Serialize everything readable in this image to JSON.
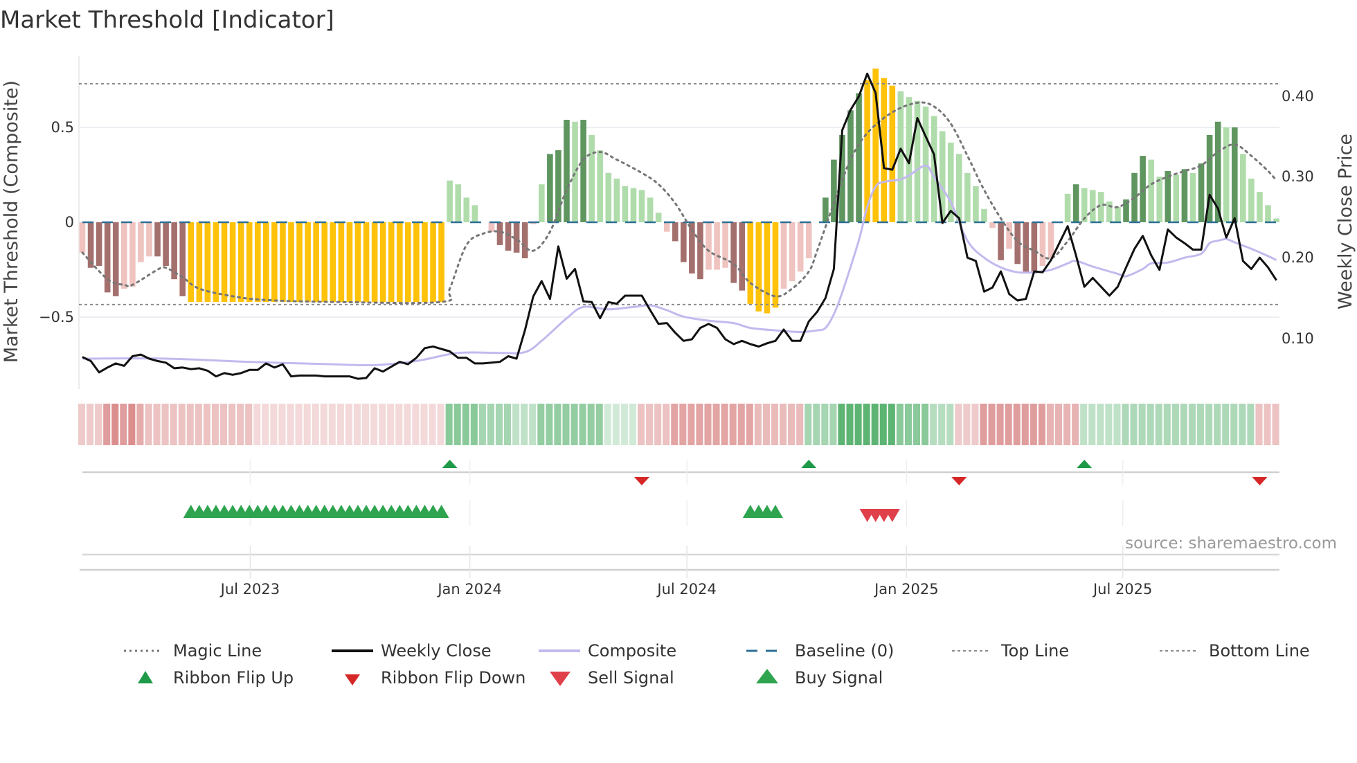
{
  "chart_data": {
    "type": "bar",
    "title": "Market Threshold [Indicator]",
    "ylabel": "Market Threshold (Composite)",
    "y2label": "Weekly Close Price",
    "ylim": [
      -0.85,
      0.87
    ],
    "y2lim": [
      0.02,
      0.45
    ],
    "yticks": [
      {
        "v": 0.5,
        "label": "0.5"
      },
      {
        "v": 0,
        "label": "0"
      },
      {
        "v": -0.5,
        "label": "−0.5"
      }
    ],
    "y2ticks": [
      {
        "v": 0.4,
        "label": "0.40"
      },
      {
        "v": 0.3,
        "label": "0.30"
      },
      {
        "v": 0.2,
        "label": "0.20"
      },
      {
        "v": 0.1,
        "label": "0.10"
      }
    ],
    "xticks": [
      {
        "week": 20.1,
        "label": "Jul 2023"
      },
      {
        "week": 46.4,
        "label": "Jan 2024"
      },
      {
        "week": 72.4,
        "label": "Jul 2024"
      },
      {
        "week": 98.7,
        "label": "Jan 2025"
      },
      {
        "week": 124.6,
        "label": "Jul 2025"
      }
    ],
    "weeks": 144,
    "top_line": 0.73,
    "bottom_line": -0.434,
    "bar_colors": {
      "D": "#a4706d",
      "P": "#efc3bf",
      "Y": "#ffc20a",
      "G": "#5f9660",
      "L": "#b0dcab"
    },
    "bar_kinds": "PDDDDPPPPDDDDYYYYYYYYYYYYYYYYYYYYYYYYYYYYYYYLLLLNPDDDDPLGGGLGLLLLLLLLLPDDDDPPPDDYYYYPPPPNGGGGGYYYYLLLLLLLLLLLPDPDDDPPNLGLLLLLGGGLLGLGLGGGLGLLLLL",
    "composite_bars": [
      -0.16,
      -0.24,
      -0.23,
      -0.37,
      -0.39,
      -0.35,
      -0.34,
      -0.21,
      -0.18,
      -0.18,
      -0.23,
      -0.3,
      -0.39,
      -0.42,
      -0.42,
      -0.42,
      -0.42,
      -0.42,
      -0.42,
      -0.42,
      -0.42,
      -0.42,
      -0.42,
      -0.42,
      -0.42,
      -0.42,
      -0.42,
      -0.42,
      -0.42,
      -0.42,
      -0.42,
      -0.42,
      -0.42,
      -0.42,
      -0.42,
      -0.42,
      -0.42,
      -0.42,
      -0.42,
      -0.42,
      -0.42,
      -0.42,
      -0.42,
      -0.42,
      0.22,
      0.2,
      0.13,
      0.09,
      null,
      -0.05,
      -0.12,
      -0.15,
      -0.16,
      -0.19,
      -0.01,
      0.2,
      0.36,
      0.38,
      0.54,
      0.53,
      0.54,
      0.46,
      0.38,
      0.26,
      0.23,
      0.19,
      0.18,
      0.17,
      0.13,
      0.05,
      -0.05,
      -0.1,
      -0.21,
      -0.27,
      -0.3,
      -0.25,
      -0.25,
      -0.24,
      -0.32,
      -0.36,
      -0.43,
      -0.47,
      -0.48,
      -0.45,
      -0.35,
      -0.31,
      -0.26,
      -0.19,
      null,
      0.13,
      0.33,
      0.46,
      0.59,
      0.68,
      0.75,
      0.81,
      0.76,
      0.72,
      0.69,
      0.66,
      0.64,
      0.61,
      0.56,
      0.48,
      0.42,
      0.36,
      0.26,
      0.19,
      0.07,
      -0.03,
      -0.2,
      -0.14,
      -0.22,
      -0.27,
      -0.27,
      -0.23,
      -0.19,
      null,
      0.15,
      0.2,
      0.18,
      0.17,
      0.16,
      0.11,
      0.08,
      0.12,
      0.26,
      0.35,
      0.33,
      0.24,
      0.27,
      0.25,
      0.28,
      0.26,
      0.31,
      0.46,
      0.53,
      0.5,
      0.5,
      0.36,
      0.23,
      0.16,
      0.09,
      0.02
    ],
    "magic_line": [
      [
        0,
        -0.16
      ],
      [
        3,
        -0.3
      ],
      [
        5,
        -0.33
      ],
      [
        6,
        -0.33
      ],
      [
        9,
        -0.25
      ],
      [
        10,
        -0.24
      ],
      [
        12,
        -0.29
      ],
      [
        14,
        -0.35
      ],
      [
        18,
        -0.39
      ],
      [
        22,
        -0.41
      ],
      [
        30,
        -0.42
      ],
      [
        43,
        -0.42
      ],
      [
        44,
        -0.35
      ],
      [
        46,
        -0.12
      ],
      [
        48,
        -0.06
      ],
      [
        50,
        -0.05
      ],
      [
        52,
        -0.09
      ],
      [
        54,
        -0.15
      ],
      [
        56,
        -0.05
      ],
      [
        58,
        0.17
      ],
      [
        60,
        0.33
      ],
      [
        62,
        0.37
      ],
      [
        64,
        0.33
      ],
      [
        67,
        0.26
      ],
      [
        69,
        0.2
      ],
      [
        71,
        0.1
      ],
      [
        73,
        -0.04
      ],
      [
        75,
        -0.15
      ],
      [
        78,
        -0.22
      ],
      [
        80,
        -0.32
      ],
      [
        83,
        -0.39
      ],
      [
        85,
        -0.35
      ],
      [
        87,
        -0.26
      ],
      [
        88,
        -0.15
      ],
      [
        90,
        0.1
      ],
      [
        92,
        0.33
      ],
      [
        94,
        0.47
      ],
      [
        97,
        0.58
      ],
      [
        100,
        0.63
      ],
      [
        102,
        0.61
      ],
      [
        104,
        0.52
      ],
      [
        106,
        0.35
      ],
      [
        108,
        0.17
      ],
      [
        110,
        0.02
      ],
      [
        112,
        -0.1
      ],
      [
        114,
        -0.15
      ],
      [
        116,
        -0.19
      ],
      [
        118,
        -0.1
      ],
      [
        120,
        0.02
      ],
      [
        122,
        0.09
      ],
      [
        124,
        0.08
      ],
      [
        126,
        0.13
      ],
      [
        128,
        0.2
      ],
      [
        130,
        0.24
      ],
      [
        132,
        0.27
      ],
      [
        134,
        0.3
      ],
      [
        136,
        0.37
      ],
      [
        138,
        0.41
      ],
      [
        140,
        0.35
      ],
      [
        142,
        0.27
      ],
      [
        143,
        0.22
      ]
    ],
    "weekly_close": [
      0.077,
      0.072,
      0.058,
      0.064,
      0.069,
      0.066,
      0.078,
      0.08,
      0.075,
      0.072,
      0.07,
      0.063,
      0.064,
      0.062,
      0.063,
      0.06,
      0.053,
      0.057,
      0.055,
      0.057,
      0.061,
      0.061,
      0.069,
      0.064,
      0.068,
      0.053,
      0.054,
      0.054,
      0.054,
      0.053,
      0.053,
      0.053,
      0.053,
      0.05,
      0.051,
      0.063,
      0.059,
      0.065,
      0.071,
      0.068,
      0.076,
      0.088,
      0.09,
      0.087,
      0.084,
      0.076,
      0.076,
      0.069,
      0.069,
      0.07,
      0.071,
      0.078,
      0.075,
      0.11,
      0.152,
      0.171,
      0.149,
      0.214,
      0.174,
      0.186,
      0.146,
      0.145,
      0.125,
      0.145,
      0.143,
      0.153,
      0.153,
      0.153,
      0.135,
      0.118,
      0.119,
      0.107,
      0.097,
      0.099,
      0.113,
      0.118,
      0.113,
      0.099,
      0.093,
      0.097,
      0.093,
      0.09,
      0.094,
      0.097,
      0.111,
      0.097,
      0.097,
      0.121,
      0.133,
      0.15,
      0.186,
      0.358,
      0.383,
      0.4,
      0.428,
      0.404,
      0.311,
      0.309,
      0.335,
      0.317,
      0.373,
      0.35,
      0.328,
      0.243,
      0.258,
      0.249,
      0.2,
      0.196,
      0.158,
      0.163,
      0.183,
      0.155,
      0.147,
      0.149,
      0.183,
      0.182,
      0.197,
      0.218,
      0.239,
      0.203,
      0.164,
      0.175,
      0.164,
      0.153,
      0.164,
      0.188,
      0.211,
      0.227,
      0.203,
      0.185,
      0.235,
      0.225,
      0.218,
      0.21,
      0.21,
      0.278,
      0.261,
      0.225,
      0.249,
      0.196,
      0.186,
      0.2,
      0.188,
      0.172
    ],
    "composite_line": [
      [
        0,
        0.075
      ],
      [
        10,
        0.075
      ],
      [
        20,
        0.071
      ],
      [
        30,
        0.068
      ],
      [
        35,
        0.067
      ],
      [
        40,
        0.072
      ],
      [
        45,
        0.082
      ],
      [
        50,
        0.082
      ],
      [
        53,
        0.083
      ],
      [
        55,
        0.097
      ],
      [
        58,
        0.125
      ],
      [
        60,
        0.139
      ],
      [
        63,
        0.136
      ],
      [
        66,
        0.139
      ],
      [
        68,
        0.141
      ],
      [
        70,
        0.135
      ],
      [
        72,
        0.127
      ],
      [
        75,
        0.122
      ],
      [
        78,
        0.119
      ],
      [
        80,
        0.113
      ],
      [
        83,
        0.11
      ],
      [
        86,
        0.108
      ],
      [
        88,
        0.11
      ],
      [
        89,
        0.113
      ],
      [
        90,
        0.13
      ],
      [
        91,
        0.157
      ],
      [
        93,
        0.222
      ],
      [
        94,
        0.263
      ],
      [
        95,
        0.288
      ],
      [
        96,
        0.294
      ],
      [
        98,
        0.297
      ],
      [
        99,
        0.302
      ],
      [
        101,
        0.314
      ],
      [
        102,
        0.3
      ],
      [
        104,
        0.269
      ],
      [
        106,
        0.221
      ],
      [
        108,
        0.2
      ],
      [
        110,
        0.188
      ],
      [
        112,
        0.182
      ],
      [
        114,
        0.182
      ],
      [
        116,
        0.185
      ],
      [
        118,
        0.193
      ],
      [
        119,
        0.196
      ],
      [
        121,
        0.189
      ],
      [
        124,
        0.18
      ],
      [
        125,
        0.177
      ],
      [
        127,
        0.186
      ],
      [
        128,
        0.193
      ],
      [
        130,
        0.194
      ],
      [
        132,
        0.2
      ],
      [
        134,
        0.205
      ],
      [
        135,
        0.218
      ],
      [
        136,
        0.221
      ],
      [
        137,
        0.223
      ],
      [
        138,
        0.219
      ],
      [
        140,
        0.211
      ],
      [
        142,
        0.202
      ],
      [
        143,
        0.197
      ]
    ],
    "ribbon": [
      {
        "from": 0,
        "to": 2,
        "v": -0.3
      },
      {
        "from": 3,
        "to": 3,
        "v": -0.6
      },
      {
        "from": 4,
        "to": 4,
        "v": -0.7
      },
      {
        "from": 5,
        "to": 5,
        "v": -0.6
      },
      {
        "from": 6,
        "to": 6,
        "v": -0.7
      },
      {
        "from": 7,
        "to": 7,
        "v": -0.5
      },
      {
        "from": 8,
        "to": 20,
        "v": -0.35
      },
      {
        "from": 21,
        "to": 43,
        "v": -0.2
      },
      {
        "from": 44,
        "to": 47,
        "v": 0.6
      },
      {
        "from": 48,
        "to": 51,
        "v": 0.45
      },
      {
        "from": 52,
        "to": 54,
        "v": 0.3
      },
      {
        "from": 55,
        "to": 62,
        "v": 0.55
      },
      {
        "from": 63,
        "to": 66,
        "v": 0.2
      },
      {
        "from": 67,
        "to": 70,
        "v": -0.35
      },
      {
        "from": 71,
        "to": 80,
        "v": -0.55
      },
      {
        "from": 81,
        "to": 86,
        "v": -0.4
      },
      {
        "from": 87,
        "to": 90,
        "v": 0.45
      },
      {
        "from": 91,
        "to": 97,
        "v": 0.85
      },
      {
        "from": 98,
        "to": 101,
        "v": 0.6
      },
      {
        "from": 102,
        "to": 104,
        "v": 0.35
      },
      {
        "from": 105,
        "to": 107,
        "v": -0.3
      },
      {
        "from": 108,
        "to": 115,
        "v": -0.6
      },
      {
        "from": 116,
        "to": 119,
        "v": -0.45
      },
      {
        "from": 120,
        "to": 124,
        "v": 0.3
      },
      {
        "from": 125,
        "to": 140,
        "v": 0.4
      },
      {
        "from": 141,
        "to": 143,
        "v": -0.35
      }
    ],
    "ribbon_flip_up_weeks": [
      44,
      87,
      120
    ],
    "ribbon_flip_down_weeks": [
      67,
      105,
      141
    ],
    "buy_signal_weeks": [
      13,
      14,
      15,
      16,
      17,
      18,
      19,
      20,
      21,
      22,
      23,
      24,
      25,
      26,
      27,
      28,
      29,
      30,
      31,
      32,
      33,
      34,
      35,
      36,
      37,
      38,
      39,
      40,
      41,
      42,
      43,
      80,
      81,
      82,
      83
    ],
    "sell_signal_weeks": [
      94,
      95,
      96,
      97
    ],
    "colors": {
      "close": "#111111",
      "composite": "#c3b9ee",
      "magic": "#777777",
      "baseline": "#2b6f94",
      "guide": "#8a8a8a",
      "flip_up": "#1e9a48",
      "flip_down": "#d62728",
      "buy": "#2ea44f",
      "sell": "#e0404a",
      "ribbon_red": "#c85050",
      "ribbon_green": "#2e9e4a"
    },
    "legend": {
      "placement": "bottom",
      "items": [
        {
          "label": "Magic Line"
        },
        {
          "label": "Weekly Close"
        },
        {
          "label": "Composite"
        },
        {
          "label": "Baseline (0)"
        },
        {
          "label": "Top Line"
        },
        {
          "label": "Bottom Line"
        },
        {
          "label": "Ribbon Flip Up"
        },
        {
          "label": "Ribbon Flip Down"
        },
        {
          "label": "Sell Signal"
        },
        {
          "label": "Buy Signal"
        }
      ]
    },
    "source": "source: sharemaestro.com"
  }
}
